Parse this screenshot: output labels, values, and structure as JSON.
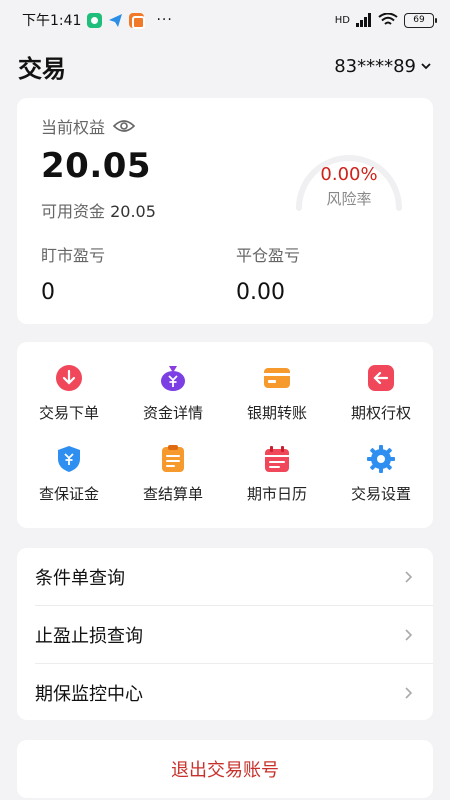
{
  "status_bar": {
    "time": "下午1:41",
    "dots": "···",
    "network_label": "HD",
    "battery": "69"
  },
  "header": {
    "title": "交易",
    "account": "83****89"
  },
  "equity": {
    "label": "当前权益",
    "value": "20.05",
    "available_label": "可用资金",
    "available_value": "20.05",
    "risk_rate_value": "0.00%",
    "risk_rate_label": "风险率",
    "mark_to_market_label": "盯市盈亏",
    "mark_to_market_value": "0",
    "close_pl_label": "平仓盈亏",
    "close_pl_value": "0.00"
  },
  "functions": [
    {
      "label": "交易下单",
      "icon": "order-icon"
    },
    {
      "label": "资金详情",
      "icon": "money-bag-icon"
    },
    {
      "label": "银期转账",
      "icon": "bank-card-icon"
    },
    {
      "label": "期权行权",
      "icon": "exercise-icon"
    },
    {
      "label": "查保证金",
      "icon": "shield-yen-icon"
    },
    {
      "label": "查结算单",
      "icon": "settlement-doc-icon"
    },
    {
      "label": "期市日历",
      "icon": "calendar-icon"
    },
    {
      "label": "交易设置",
      "icon": "gear-icon"
    }
  ],
  "queries": [
    {
      "label": "条件单查询"
    },
    {
      "label": "止盈止损查询"
    },
    {
      "label": "期保监控中心"
    }
  ],
  "logout_label": "退出交易账号",
  "colors": {
    "risk": "#d0221b",
    "logout": "#c8312b",
    "background": "#f3f3f5"
  }
}
